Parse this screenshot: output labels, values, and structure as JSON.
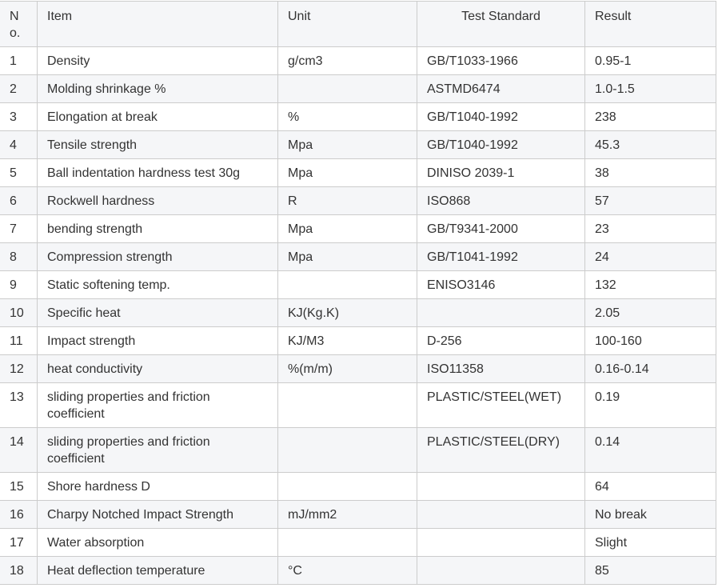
{
  "table": {
    "headers": {
      "no": "No.",
      "item": "Item",
      "unit": "Unit",
      "standard": "Test Standard",
      "result": "Result"
    },
    "rows": [
      {
        "no": "1",
        "item": "Density",
        "unit": "g/cm3",
        "standard": "GB/T1033-1966",
        "result": "0.95-1"
      },
      {
        "no": "2",
        "item": "Molding shrinkage %",
        "unit": "",
        "standard": "ASTMD6474",
        "result": "1.0-1.5"
      },
      {
        "no": "3",
        "item": "Elongation at break",
        "unit": "%",
        "standard": "GB/T1040-1992",
        "result": "238"
      },
      {
        "no": "4",
        "item": "Tensile strength",
        "unit": "Mpa",
        "standard": "GB/T1040-1992",
        "result": "45.3"
      },
      {
        "no": "5",
        "item": "Ball indentation hardness test 30g",
        "unit": "Mpa",
        "standard": "DINISO 2039-1",
        "result": "38"
      },
      {
        "no": "6",
        "item": "Rockwell hardness",
        "unit": "R",
        "standard": "ISO868",
        "result": "57"
      },
      {
        "no": "7",
        "item": "bending strength",
        "unit": "Mpa",
        "standard": "GB/T9341-2000",
        "result": "23"
      },
      {
        "no": "8",
        "item": "Compression strength",
        "unit": "Mpa",
        "standard": "GB/T1041-1992",
        "result": "24"
      },
      {
        "no": "9",
        "item": "Static softening temp.",
        "unit": "",
        "standard": "ENISO3146",
        "result": "132"
      },
      {
        "no": "10",
        "item": "Specific heat",
        "unit": "KJ(Kg.K)",
        "standard": "",
        "result": "2.05"
      },
      {
        "no": "11",
        "item": "Impact strength",
        "unit": "KJ/M3",
        "standard": "D-256",
        "result": "100-160"
      },
      {
        "no": "12",
        "item": "heat conductivity",
        "unit": "%(m/m)",
        "standard": "ISO11358",
        "result": "0.16-0.14"
      },
      {
        "no": "13",
        "item": "sliding properties and friction coefficient",
        "unit": "",
        "standard": "PLASTIC/STEEL(WET)",
        "result": "0.19"
      },
      {
        "no": "14",
        "item": "sliding properties and friction coefficient",
        "unit": "",
        "standard": "PLASTIC/STEEL(DRY)",
        "result": "0.14"
      },
      {
        "no": "15",
        "item": "Shore hardness D",
        "unit": "",
        "standard": "",
        "result": "64"
      },
      {
        "no": "16",
        "item": "Charpy Notched Impact Strength",
        "unit": "mJ/mm2",
        "standard": "",
        "result": "No break"
      },
      {
        "no": "17",
        "item": "Water absorption",
        "unit": "",
        "standard": "",
        "result": "Slight"
      },
      {
        "no": "18",
        "item": "Heat deflection temperature",
        "unit": "°C",
        "standard": "",
        "result": "85"
      }
    ]
  }
}
